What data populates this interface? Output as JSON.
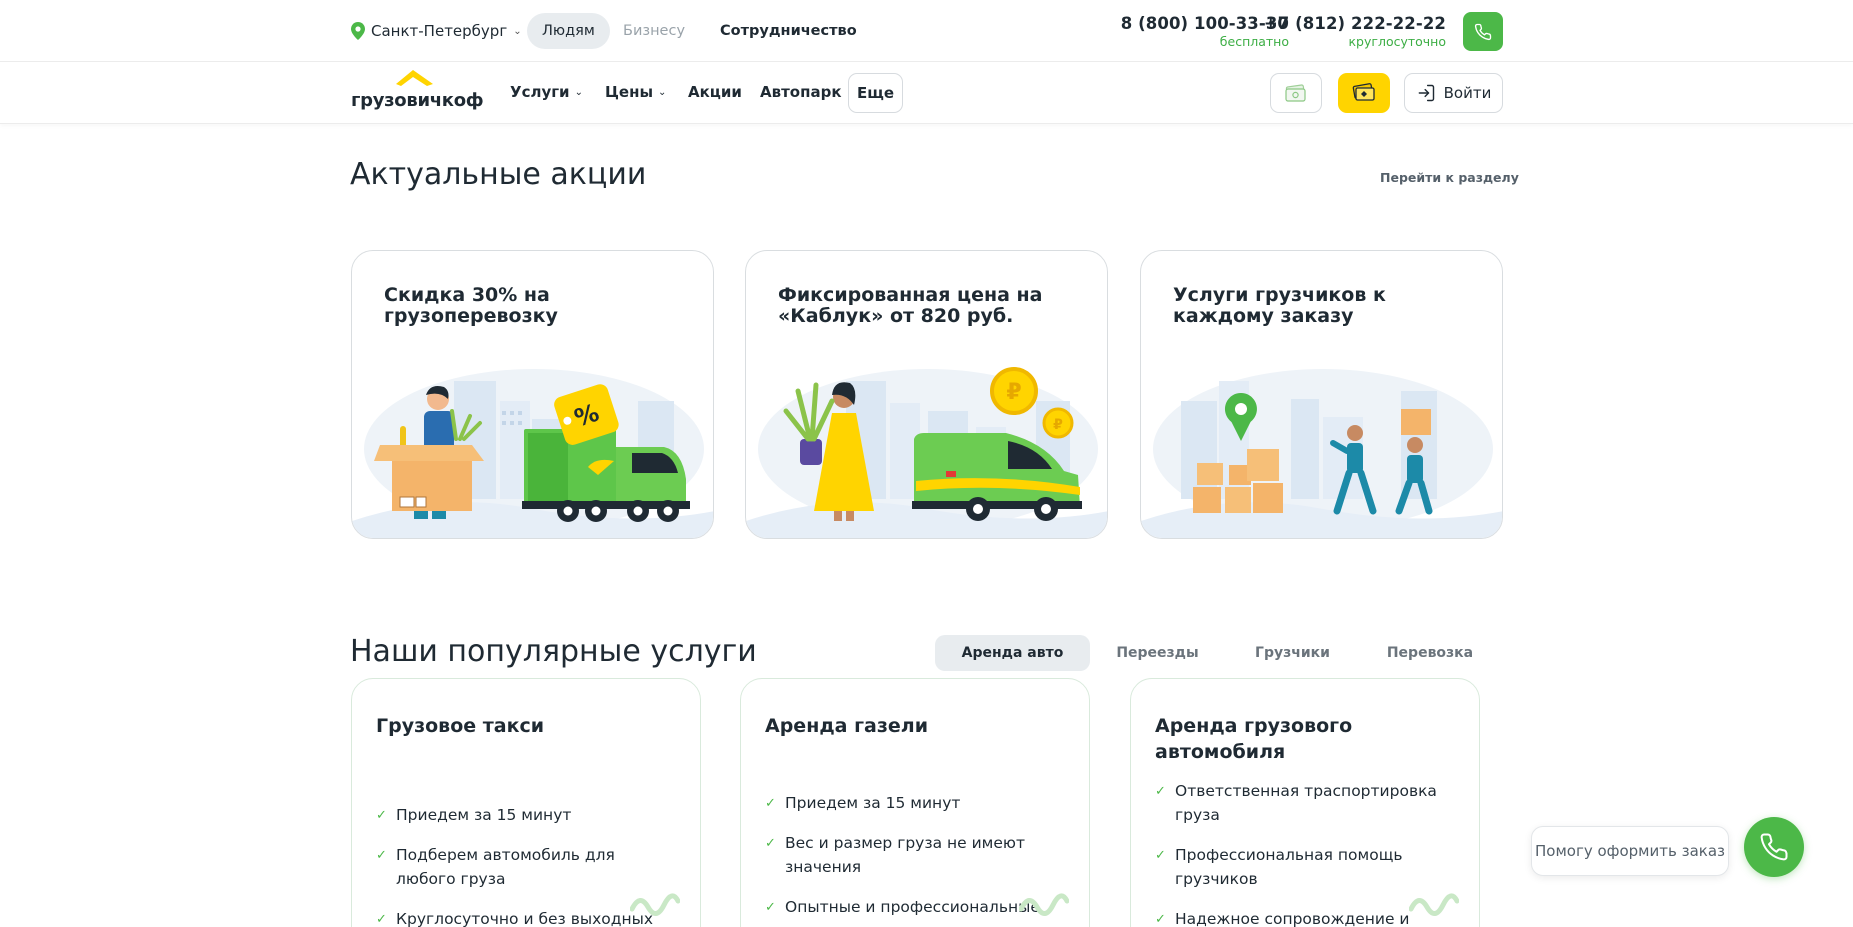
{
  "header": {
    "city": "Санкт-Петербург",
    "audience_tabs": [
      "Людям",
      "Бизнесу",
      "Сотрудничество"
    ],
    "phones": [
      {
        "number": "8 (800) 100-33-30",
        "note": "бесплатно"
      },
      {
        "number": "+7 (812) 222-22-22",
        "note": "круглосуточно"
      }
    ]
  },
  "nav": {
    "logo_text": "грузовичкоф",
    "items": [
      "Услуги",
      "Цены",
      "Акции",
      "Автопарк"
    ],
    "more_label": "Еще",
    "login_label": "Войти"
  },
  "promos": {
    "title": "Актуальные акции",
    "link": "Перейти к разделу",
    "cards": [
      {
        "title": "Скидка 30% на грузоперевозку"
      },
      {
        "title": "Фиксированная цена на «Каблук» от 820 руб."
      },
      {
        "title": "Услуги грузчиков к каждому заказу"
      }
    ]
  },
  "services": {
    "title": "Наши популярные услуги",
    "tabs": [
      "Аренда авто",
      "Переезды",
      "Грузчики",
      "Перевозка"
    ],
    "active_tab": "Аренда авто",
    "cards": [
      {
        "title": "Грузовое такси",
        "features": [
          "Приедем за 15 минут",
          "Подберем автомобиль для любого груза",
          "Круглосуточно и без выходных"
        ]
      },
      {
        "title": "Аренда газели",
        "features": [
          "Приедем за 15 минут",
          "Вес и размер груза не имеют значения",
          "Опытные и профессиональные"
        ]
      },
      {
        "title": "Аренда грузового автомобиля",
        "features": [
          "Ответственная траспортировка груза",
          "Профессиональная помощь грузчиков",
          "Надежное сопровождение и"
        ]
      }
    ]
  },
  "help": {
    "label": "Помогу оформить заказ"
  },
  "colors": {
    "brand_green": "#4cb848",
    "brand_yellow": "#ffd400",
    "text_dark": "#1f2a33"
  },
  "icons": [
    "location-pin-icon",
    "chevron-down-icon",
    "phone-icon",
    "wallet-icon",
    "bonus-card-icon",
    "login-icon",
    "check-icon"
  ]
}
